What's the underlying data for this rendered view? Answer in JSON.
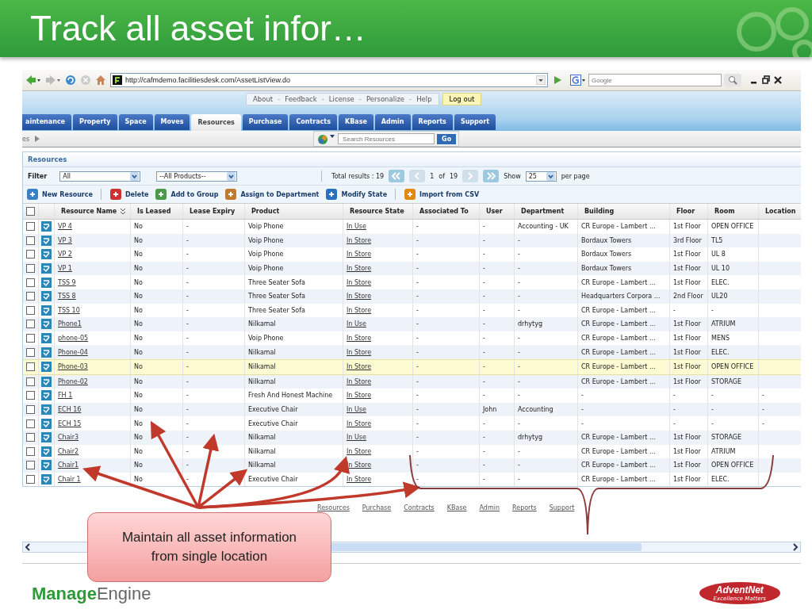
{
  "slide": {
    "title": "Track all asset infor…"
  },
  "browser": {
    "address": "http://cafmdemo.facilitiesdesk.com/AssetListView.do",
    "search_placeholder": "Google"
  },
  "top_links": [
    {
      "kind": "link",
      "label": "About"
    },
    {
      "kind": "separator",
      "label": "-"
    },
    {
      "kind": "link",
      "label": "Feedback"
    },
    {
      "kind": "separator",
      "label": "-"
    },
    {
      "kind": "link",
      "label": "License"
    },
    {
      "kind": "separator",
      "label": "-"
    },
    {
      "kind": "link",
      "label": "Personalize"
    },
    {
      "kind": "separator",
      "label": "-"
    },
    {
      "kind": "link",
      "label": "Help"
    }
  ],
  "logout": "Log out",
  "tabs": [
    {
      "label": "aintenance",
      "selected": false
    },
    {
      "label": "Property",
      "selected": false
    },
    {
      "label": "Space",
      "selected": false
    },
    {
      "label": "Moves",
      "selected": false
    },
    {
      "label": "Resources",
      "selected": true
    },
    {
      "label": "Purchase",
      "selected": false
    },
    {
      "label": "Contracts",
      "selected": false
    },
    {
      "label": "KBase",
      "selected": false
    },
    {
      "label": "Admin",
      "selected": false
    },
    {
      "label": "Reports",
      "selected": false
    },
    {
      "label": "Support",
      "selected": false
    }
  ],
  "breadcrumb": "es",
  "search": {
    "placeholder": "Search Resources",
    "button": "Go"
  },
  "panel": {
    "title": "Resources",
    "filter_label": "Filter",
    "filter": "All",
    "product_filter": "--All Products--",
    "total": "Total results : 19",
    "page": "1",
    "of": "of",
    "pages": "19",
    "show": "Show",
    "per_page_value": "25",
    "per_page": "per page"
  },
  "actions": [
    {
      "label": "New Resource",
      "kind": "new"
    },
    {
      "label": "Delete",
      "kind": "delete"
    },
    {
      "label": "Add to Group",
      "kind": "group"
    },
    {
      "label": "Assign to Department",
      "kind": "assign"
    },
    {
      "label": "Modify State",
      "kind": "state"
    },
    {
      "label": "Import from CSV",
      "kind": "import"
    }
  ],
  "table": {
    "select_all_checked": false,
    "columns": [
      "Resource Name",
      "Is Leased",
      "Lease Expiry",
      "Product",
      "Resource State",
      "Associated To",
      "User",
      "Department",
      "Building",
      "Floor",
      "Room",
      "Location"
    ],
    "rows": [
      {
        "checked": false,
        "highlighted": false,
        "name": "VP 4",
        "leased": "No",
        "expiry": "-",
        "product": "Voip Phone",
        "state": "In Use",
        "associated": "-",
        "user": "-",
        "department": "Accounting - UK",
        "building": "CR Europe - Lambert ...",
        "floor": "1st Floor",
        "room": "OPEN OFFICE"
      },
      {
        "checked": false,
        "highlighted": false,
        "name": "VP 3",
        "leased": "No",
        "expiry": "-",
        "product": "Voip Phone",
        "state": "In Store",
        "associated": "-",
        "user": "-",
        "department": "-",
        "building": "Bordaux Towers",
        "floor": "3rd Floor",
        "room": "TL5"
      },
      {
        "checked": false,
        "highlighted": false,
        "name": "VP 2",
        "leased": "No",
        "expiry": "-",
        "product": "Voip Phone",
        "state": "In Store",
        "associated": "-",
        "user": "-",
        "department": "-",
        "building": "Bordaux Towers",
        "floor": "1st Floor",
        "room": "UL 8"
      },
      {
        "checked": false,
        "highlighted": false,
        "name": "VP 1",
        "leased": "No",
        "expiry": "-",
        "product": "Voip Phone",
        "state": "In Store",
        "associated": "-",
        "user": "-",
        "department": "-",
        "building": "Bordaux Towers",
        "floor": "1st Floor",
        "room": "UL 10"
      },
      {
        "checked": false,
        "highlighted": false,
        "name": "TSS 9",
        "leased": "No",
        "expiry": "-",
        "product": "Three Seater Sofa",
        "state": "In Store",
        "associated": "-",
        "user": "-",
        "department": "-",
        "building": "CR Europe - Lambert ...",
        "floor": "1st Floor",
        "room": "ELEC."
      },
      {
        "checked": false,
        "highlighted": false,
        "name": "TSS 8",
        "leased": "No",
        "expiry": "-",
        "product": "Three Seater Sofa",
        "state": "In Store",
        "associated": "-",
        "user": "-",
        "department": "-",
        "building": "Headquarters Corpora ...",
        "floor": "2nd Floor",
        "room": "UL20"
      },
      {
        "checked": false,
        "highlighted": false,
        "name": "TSS 10",
        "leased": "No",
        "expiry": "-",
        "product": "Three Seater Sofa",
        "state": "In Store",
        "associated": "-",
        "user": "-",
        "department": "-",
        "building": "CR Europe - Lambert ...",
        "floor": "-",
        "room": "-"
      },
      {
        "checked": false,
        "highlighted": false,
        "name": "Phone1",
        "leased": "No",
        "expiry": "-",
        "product": "Nilkamal",
        "state": "In Use",
        "associated": "-",
        "user": "-",
        "department": "drhytyg",
        "building": "CR Europe - Lambert ...",
        "floor": "1st Floor",
        "room": "ATRIUM"
      },
      {
        "checked": false,
        "highlighted": false,
        "name": "phone-05",
        "leased": "No",
        "expiry": "-",
        "product": "Voip Phone",
        "state": "In Store",
        "associated": "-",
        "user": "-",
        "department": "-",
        "building": "CR Europe - Lambert ...",
        "floor": "1st Floor",
        "room": "MENS"
      },
      {
        "checked": false,
        "highlighted": false,
        "name": "Phone-04",
        "leased": "No",
        "expiry": "-",
        "product": "Nilkamal",
        "state": "In Store",
        "associated": "-",
        "user": "-",
        "department": "-",
        "building": "CR Europe - Lambert ...",
        "floor": "1st Floor",
        "room": "ELEC."
      },
      {
        "checked": false,
        "highlighted": true,
        "name": "Phone-03",
        "leased": "No",
        "expiry": "-",
        "product": "Nilkamal",
        "state": "In Store",
        "associated": "-",
        "user": "-",
        "department": "-",
        "building": "CR Europe - Lambert ...",
        "floor": "1st Floor",
        "room": "OPEN OFFICE"
      },
      {
        "checked": false,
        "highlighted": false,
        "name": "Phone-02",
        "leased": "No",
        "expiry": "-",
        "product": "Nilkamal",
        "state": "In Store",
        "associated": "-",
        "user": "-",
        "department": "-",
        "building": "CR Europe - Lambert ...",
        "floor": "1st Floor",
        "room": "STORAGE"
      },
      {
        "checked": false,
        "highlighted": false,
        "name": "FH 1",
        "leased": "No",
        "expiry": "-",
        "product": "Fresh And Honest Machine",
        "state": "In Store",
        "associated": "-",
        "user": "-",
        "department": "-",
        "building": "-",
        "floor": "-",
        "room": "-",
        "location": "-"
      },
      {
        "checked": false,
        "highlighted": false,
        "name": "ECH 16",
        "leased": "No",
        "expiry": "-",
        "product": "Executive Chair",
        "state": "In Use",
        "associated": "-",
        "user": "John",
        "department": "Accounting",
        "building": "-",
        "floor": "-",
        "room": "-",
        "location": "-"
      },
      {
        "checked": false,
        "highlighted": false,
        "name": "ECH 15",
        "leased": "No",
        "expiry": "-",
        "product": "Executive Chair",
        "state": "In Store",
        "associated": "-",
        "user": "-",
        "department": "-",
        "building": "-",
        "floor": "-",
        "room": "-",
        "location": "-"
      },
      {
        "checked": false,
        "highlighted": false,
        "name": "Chair3",
        "leased": "No",
        "expiry": "-",
        "product": "Nilkamal",
        "state": "In Use",
        "associated": "-",
        "user": "-",
        "department": "drhytyg",
        "building": "CR Europe - Lambert ...",
        "floor": "1st Floor",
        "room": "STORAGE"
      },
      {
        "checked": false,
        "highlighted": false,
        "name": "Chair2",
        "leased": "No",
        "expiry": "-",
        "product": "Nilkamal",
        "state": "In Store",
        "associated": "-",
        "user": "-",
        "department": "-",
        "building": "CR Europe - Lambert ...",
        "floor": "1st Floor",
        "room": "ATRIUM"
      },
      {
        "checked": false,
        "highlighted": false,
        "name": "Chair1",
        "leased": "No",
        "expiry": "-",
        "product": "Nilkamal",
        "state": "In Store",
        "associated": "-",
        "user": "-",
        "department": "-",
        "building": "CR Europe - Lambert ...",
        "floor": "1st Floor",
        "room": "OPEN OFFICE"
      },
      {
        "checked": false,
        "highlighted": false,
        "name": "Chair 1",
        "leased": "No",
        "expiry": "-",
        "product": "Executive Chair",
        "state": "In Store",
        "associated": "-",
        "user": "-",
        "department": "-",
        "building": "CR Europe - Lambert ...",
        "floor": "1st Floor",
        "room": "ELEC."
      }
    ]
  },
  "footer_links": [
    "Resources",
    "Purchase",
    "Contracts",
    "KBase",
    "Admin",
    "Reports",
    "Support"
  ],
  "callout": "Maintain all asset information from single location",
  "logos": {
    "left_bold": "Manage",
    "left": "Engine",
    "right": "AdventNet",
    "right_tagline": "Excellence Matters"
  }
}
